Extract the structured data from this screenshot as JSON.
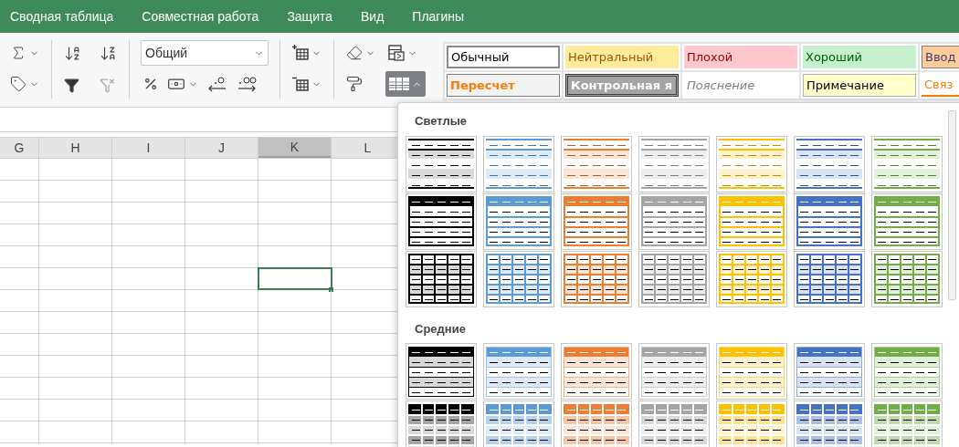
{
  "menu": [
    {
      "label": "Сводная таблица"
    },
    {
      "label": "Совместная работа"
    },
    {
      "label": "Защита"
    },
    {
      "label": "Вид"
    },
    {
      "label": "Плагины"
    }
  ],
  "number_format": {
    "value": "Общий"
  },
  "table_format_button": {
    "expanded": true
  },
  "cell_styles": [
    {
      "kind": "normal",
      "label": "Обычный"
    },
    {
      "kind": "neutral",
      "label": "Нейтральный"
    },
    {
      "kind": "bad",
      "label": "Плохой"
    },
    {
      "kind": "good",
      "label": "Хороший"
    },
    {
      "kind": "input",
      "label": "Ввод"
    },
    {
      "kind": "calculation",
      "label": "Пересчет"
    },
    {
      "kind": "check",
      "label": "Контрольная я"
    },
    {
      "kind": "explanatory",
      "label": "Пояснение"
    },
    {
      "kind": "note",
      "label": "Примечание"
    },
    {
      "kind": "linked",
      "label": "Связ"
    }
  ],
  "sheet": {
    "columns": [
      {
        "label": "G",
        "selected": false
      },
      {
        "label": "H",
        "selected": false
      },
      {
        "label": "I",
        "selected": false
      },
      {
        "label": "J",
        "selected": false
      },
      {
        "label": "K",
        "selected": true
      },
      {
        "label": "L",
        "selected": false
      }
    ],
    "rows": [
      {
        "selected": false
      },
      {
        "selected": false
      },
      {
        "selected": false
      },
      {
        "selected": false
      },
      {
        "selected": false
      },
      {
        "selected": true
      },
      {
        "selected": false
      },
      {
        "selected": false
      },
      {
        "selected": false
      },
      {
        "selected": false
      },
      {
        "selected": false
      },
      {
        "selected": false
      },
      {
        "selected": false
      }
    ]
  },
  "table_styles": {
    "sections": [
      {
        "title": "Светлые",
        "rows": [
          {
            "kind": "light-banded",
            "swatches": [
              {
                "color": "#000000"
              },
              {
                "color": "#5b9bd5"
              },
              {
                "color": "#ed7d31"
              },
              {
                "color": "#a5a5a5"
              },
              {
                "color": "#ffc000"
              },
              {
                "color": "#4472c4"
              },
              {
                "color": "#70ad47"
              }
            ]
          },
          {
            "kind": "light-header",
            "swatches": [
              {
                "color": "#000000"
              },
              {
                "color": "#5b9bd5"
              },
              {
                "color": "#ed7d31"
              },
              {
                "color": "#a5a5a5"
              },
              {
                "color": "#ffc000"
              },
              {
                "color": "#4472c4"
              },
              {
                "color": "#70ad47"
              }
            ]
          },
          {
            "kind": "light-grid",
            "swatches": [
              {
                "color": "#000000"
              },
              {
                "color": "#5b9bd5"
              },
              {
                "color": "#ed7d31"
              },
              {
                "color": "#a5a5a5"
              },
              {
                "color": "#ffc000"
              },
              {
                "color": "#4472c4"
              },
              {
                "color": "#70ad47"
              }
            ]
          }
        ]
      },
      {
        "title": "Средние",
        "rows": [
          {
            "kind": "medium-banded",
            "swatches": [
              {
                "color": "#000000"
              },
              {
                "color": "#5b9bd5"
              },
              {
                "color": "#ed7d31"
              },
              {
                "color": "#a5a5a5"
              },
              {
                "color": "#ffc000"
              },
              {
                "color": "#4472c4"
              },
              {
                "color": "#70ad47"
              }
            ]
          },
          {
            "kind": "medium-grid",
            "swatches": [
              {
                "color": "#000000"
              },
              {
                "color": "#5b9bd5"
              },
              {
                "color": "#ed7d31"
              },
              {
                "color": "#a5a5a5"
              },
              {
                "color": "#ffc000"
              },
              {
                "color": "#4472c4"
              },
              {
                "color": "#70ad47"
              }
            ]
          }
        ]
      }
    ]
  }
}
